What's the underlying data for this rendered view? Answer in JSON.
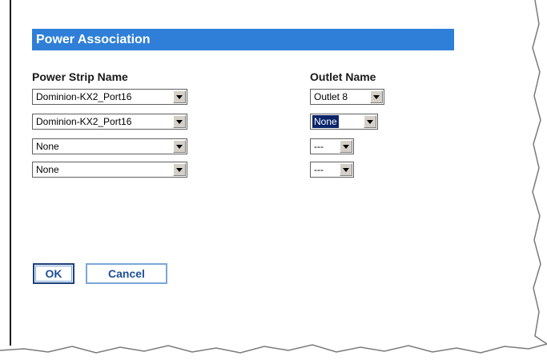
{
  "section": {
    "title": "Power Association"
  },
  "columns": {
    "power_strip": "Power Strip Name",
    "outlet": "Outlet Name"
  },
  "rows": [
    {
      "power_strip": "Dominion-KX2_Port16",
      "outlet": "Outlet 8"
    },
    {
      "power_strip": "Dominion-KX2_Port16",
      "outlet": "None"
    },
    {
      "power_strip": "None",
      "outlet": "---"
    },
    {
      "power_strip": "None",
      "outlet": "---"
    }
  ],
  "buttons": {
    "ok": "OK",
    "cancel": "Cancel"
  },
  "colors": {
    "header_bg": "#2f7fd8",
    "button_text": "#1e4f9a",
    "selection": "#0a246a"
  }
}
